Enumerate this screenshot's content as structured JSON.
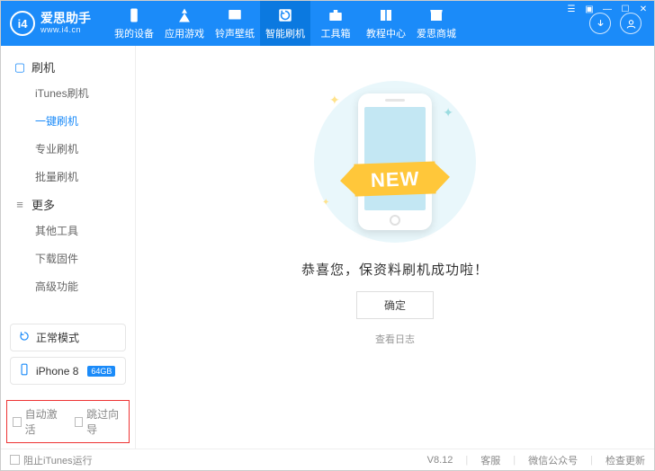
{
  "header": {
    "logo": {
      "badge": "i4",
      "title": "爱思助手",
      "sub": "www.i4.cn"
    },
    "nav": [
      {
        "key": "device",
        "label": "我的设备"
      },
      {
        "key": "apps",
        "label": "应用游戏"
      },
      {
        "key": "ringtone",
        "label": "铃声壁纸"
      },
      {
        "key": "flash",
        "label": "智能刷机",
        "active": true
      },
      {
        "key": "tools",
        "label": "工具箱"
      },
      {
        "key": "tutorial",
        "label": "教程中心"
      },
      {
        "key": "store",
        "label": "爱思商城"
      }
    ]
  },
  "sidebar": {
    "group_flash": {
      "title": "刷机",
      "items": [
        {
          "key": "itunes",
          "label": "iTunes刷机"
        },
        {
          "key": "oneclick",
          "label": "一键刷机",
          "active": true
        },
        {
          "key": "pro",
          "label": "专业刷机"
        },
        {
          "key": "batch",
          "label": "批量刷机"
        }
      ]
    },
    "group_more": {
      "title": "更多",
      "items": [
        {
          "key": "othertools",
          "label": "其他工具"
        },
        {
          "key": "download",
          "label": "下载固件"
        },
        {
          "key": "advanced",
          "label": "高级功能"
        }
      ]
    },
    "mode": {
      "label": "正常模式"
    },
    "device": {
      "name": "iPhone 8",
      "storage": "64GB"
    },
    "checks": {
      "auto_activate": "自动激活",
      "skip_guide": "跳过向导"
    }
  },
  "main": {
    "ribbon": "NEW",
    "message": "恭喜您，保资料刷机成功啦！",
    "ok": "确定",
    "view_log": "查看日志"
  },
  "footer": {
    "block_itunes": "阻止iTunes运行",
    "version": "V8.12",
    "support": "客服",
    "wechat": "微信公众号",
    "check_update": "检查更新"
  }
}
